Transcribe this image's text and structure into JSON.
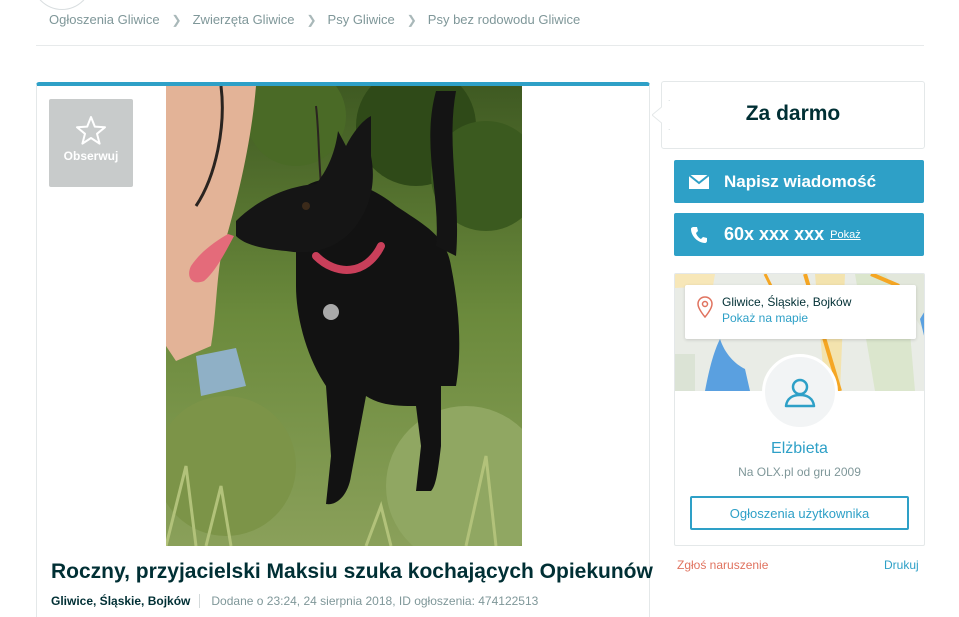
{
  "breadcrumb": [
    {
      "label": "Ogłoszenia Gliwice"
    },
    {
      "label": "Zwierzęta Gliwice"
    },
    {
      "label": "Psy Gliwice"
    },
    {
      "label": "Psy bez rodowodu Gliwice"
    }
  ],
  "ad": {
    "observe_label": "Obserwuj",
    "title": "Roczny, przyjacielski Maksiu szuka kochających Opiekunów",
    "location": "Gliwice, Śląskie, Bojków",
    "added": "Dodane o 23:24, 24 sierpnia 2018, ID ogłoszenia: 474122513"
  },
  "sidebar": {
    "price": "Za darmo",
    "message_button": "Napisz wiadomość",
    "phone": "60x xxx xxx",
    "phone_show": "Pokaż",
    "map_location": "Gliwice, Śląskie, Bojków",
    "map_link": "Pokaż na mapie",
    "user_name": "Elżbieta",
    "user_since": "Na OLX.pl od gru 2009",
    "user_ads_button": "Ogłoszenia użytkownika",
    "report_link": "Zgłoś naruszenie",
    "print_link": "Drukuj"
  },
  "colors": {
    "accent": "#2ea0c7",
    "text_dark": "#002f34",
    "text_muted": "#7f9799",
    "report": "#e0735f"
  }
}
